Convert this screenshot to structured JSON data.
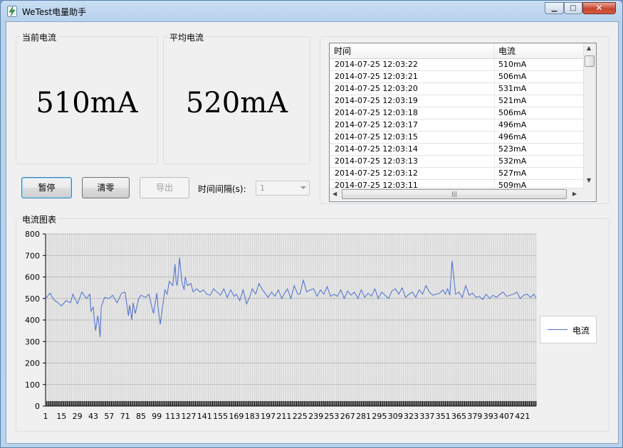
{
  "window": {
    "title": "WeTest电量助手",
    "min_glyph": "▁",
    "max_glyph": "□",
    "close_glyph": "✕",
    "app_icon": "lightning-bolt-icon"
  },
  "current": {
    "label": "当前电流",
    "value": "510mA"
  },
  "average": {
    "label": "平均电流",
    "value": "520mA"
  },
  "controls": {
    "pause_label": "暂停",
    "clear_label": "清零",
    "export_label": "导出",
    "interval_label": "时间间隔(s):",
    "interval_value": "1"
  },
  "table": {
    "headers": [
      "时间",
      "电流"
    ],
    "rows": [
      [
        "2014-07-25 12:03:22",
        "510mA"
      ],
      [
        "2014-07-25 12:03:21",
        "506mA"
      ],
      [
        "2014-07-25 12:03:20",
        "531mA"
      ],
      [
        "2014-07-25 12:03:19",
        "521mA"
      ],
      [
        "2014-07-25 12:03:18",
        "506mA"
      ],
      [
        "2014-07-25 12:03:17",
        "496mA"
      ],
      [
        "2014-07-25 12:03:15",
        "496mA"
      ],
      [
        "2014-07-25 12:03:14",
        "523mA"
      ],
      [
        "2014-07-25 12:03:13",
        "532mA"
      ],
      [
        "2014-07-25 12:03:12",
        "527mA"
      ],
      [
        "2014-07-25 12:03:11",
        "509mA"
      ]
    ]
  },
  "chart_section": {
    "label": "电流图表"
  },
  "colors": {
    "series": "#4a6fd0",
    "grid": "#c8c8c8"
  },
  "chart_data": {
    "type": "line",
    "title": "",
    "xlabel": "",
    "ylabel": "",
    "ylim": [
      0,
      800
    ],
    "yticks": [
      0,
      100,
      200,
      300,
      400,
      500,
      600,
      700,
      800
    ],
    "xlim": [
      1,
      433
    ],
    "xticks": [
      1,
      15,
      29,
      43,
      57,
      71,
      85,
      99,
      113,
      127,
      141,
      155,
      169,
      183,
      197,
      211,
      225,
      239,
      253,
      267,
      281,
      295,
      309,
      323,
      337,
      351,
      365,
      379,
      393,
      407,
      421
    ],
    "grid": true,
    "legend": "right",
    "series": [
      {
        "name": "电流",
        "x": [
          1,
          5,
          8,
          12,
          15,
          19,
          23,
          25,
          29,
          33,
          37,
          40,
          41,
          43,
          44,
          45,
          47,
          48,
          49,
          50,
          53,
          57,
          60,
          64,
          68,
          71,
          74,
          75,
          77,
          78,
          80,
          83,
          85,
          89,
          92,
          96,
          99,
          100,
          102,
          103,
          106,
          108,
          110,
          113,
          115,
          116,
          117,
          119,
          121,
          123,
          124,
          126,
          129,
          131,
          134,
          137,
          140,
          143,
          146,
          149,
          152,
          155,
          158,
          161,
          164,
          167,
          169,
          172,
          175,
          178,
          181,
          183,
          186,
          189,
          192,
          195,
          197,
          200,
          203,
          206,
          209,
          211,
          214,
          217,
          220,
          223,
          225,
          228,
          231,
          234,
          237,
          240,
          243,
          246,
          249,
          252,
          255,
          258,
          261,
          264,
          267,
          270,
          273,
          276,
          279,
          282,
          285,
          288,
          291,
          294,
          297,
          300,
          303,
          306,
          309,
          312,
          315,
          318,
          321,
          324,
          327,
          330,
          333,
          336,
          339,
          342,
          345,
          348,
          351,
          353,
          355,
          357,
          359,
          362,
          365,
          368,
          371,
          374,
          377,
          380,
          383,
          386,
          389,
          392,
          395,
          398,
          401,
          404,
          407,
          410,
          413,
          416,
          419,
          422,
          425,
          428,
          431,
          433
        ],
        "values": [
          500,
          525,
          495,
          480,
          465,
          490,
          480,
          520,
          475,
          530,
          500,
          520,
          440,
          460,
          400,
          350,
          420,
          380,
          320,
          460,
          505,
          500,
          515,
          480,
          525,
          530,
          420,
          470,
          400,
          480,
          430,
          500,
          515,
          505,
          520,
          430,
          525,
          460,
          380,
          420,
          540,
          520,
          580,
          560,
          660,
          575,
          560,
          690,
          580,
          540,
          600,
          560,
          570,
          530,
          545,
          530,
          540,
          520,
          515,
          545,
          530,
          515,
          545,
          505,
          540,
          510,
          520,
          490,
          540,
          475,
          510,
          545,
          520,
          570,
          540,
          520,
          505,
          530,
          510,
          540,
          500,
          520,
          545,
          500,
          560,
          520,
          520,
          585,
          530,
          540,
          545,
          510,
          540,
          520,
          555,
          510,
          520,
          510,
          540,
          500,
          535,
          515,
          530,
          500,
          540,
          505,
          525,
          510,
          545,
          500,
          530,
          515,
          500,
          535,
          545,
          520,
          550,
          505,
          520,
          530,
          505,
          540,
          520,
          560,
          530,
          515,
          520,
          525,
          540,
          520,
          545,
          515,
          675,
          520,
          530,
          505,
          560,
          515,
          525,
          505,
          510,
          495,
          520,
          500,
          515,
          505,
          520,
          530,
          510,
          515,
          520,
          530,
          500,
          515,
          520,
          505,
          520,
          500
        ]
      }
    ]
  }
}
